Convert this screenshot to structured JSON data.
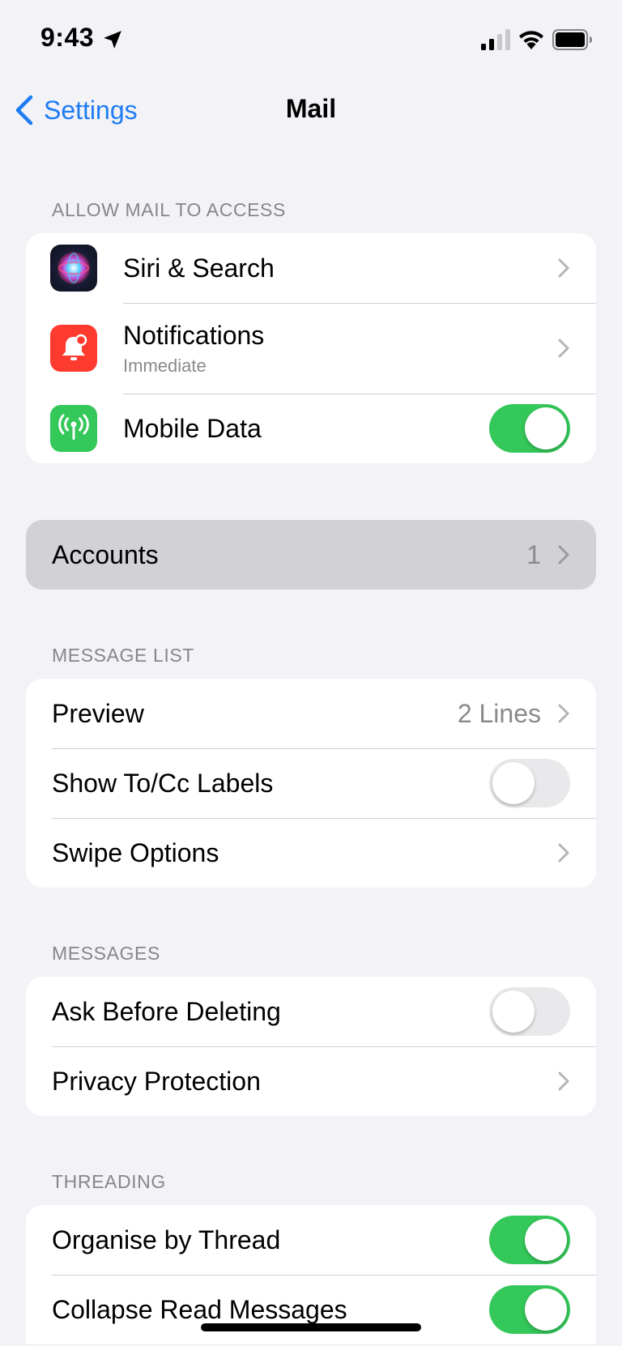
{
  "status_bar": {
    "time": "9:43"
  },
  "nav": {
    "back_label": "Settings",
    "title": "Mail"
  },
  "sections": {
    "allow_access": {
      "header": "ALLOW MAIL TO ACCESS",
      "siri": {
        "label": "Siri & Search",
        "icon": "siri-icon"
      },
      "notifications": {
        "label": "Notifications",
        "sublabel": "Immediate",
        "icon": "bell-badge-icon"
      },
      "mobile_data": {
        "label": "Mobile Data",
        "icon": "antenna-icon",
        "on": true
      }
    },
    "accounts": {
      "label": "Accounts",
      "value": "1"
    },
    "message_list": {
      "header": "MESSAGE LIST",
      "preview": {
        "label": "Preview",
        "value": "2 Lines"
      },
      "show_tocc": {
        "label": "Show To/Cc Labels",
        "on": false
      },
      "swipe": {
        "label": "Swipe Options"
      }
    },
    "messages": {
      "header": "MESSAGES",
      "ask_delete": {
        "label": "Ask Before Deleting",
        "on": false
      },
      "privacy": {
        "label": "Privacy Protection"
      }
    },
    "threading": {
      "header": "THREADING",
      "organise": {
        "label": "Organise by Thread",
        "on": true
      },
      "collapse": {
        "label": "Collapse Read Messages",
        "on": true
      }
    }
  },
  "colors": {
    "accent": "#1e7cf2",
    "toggle_on": "#34c759",
    "notifications_icon": "#ff3b30",
    "mobile_data_icon": "#34c759"
  }
}
